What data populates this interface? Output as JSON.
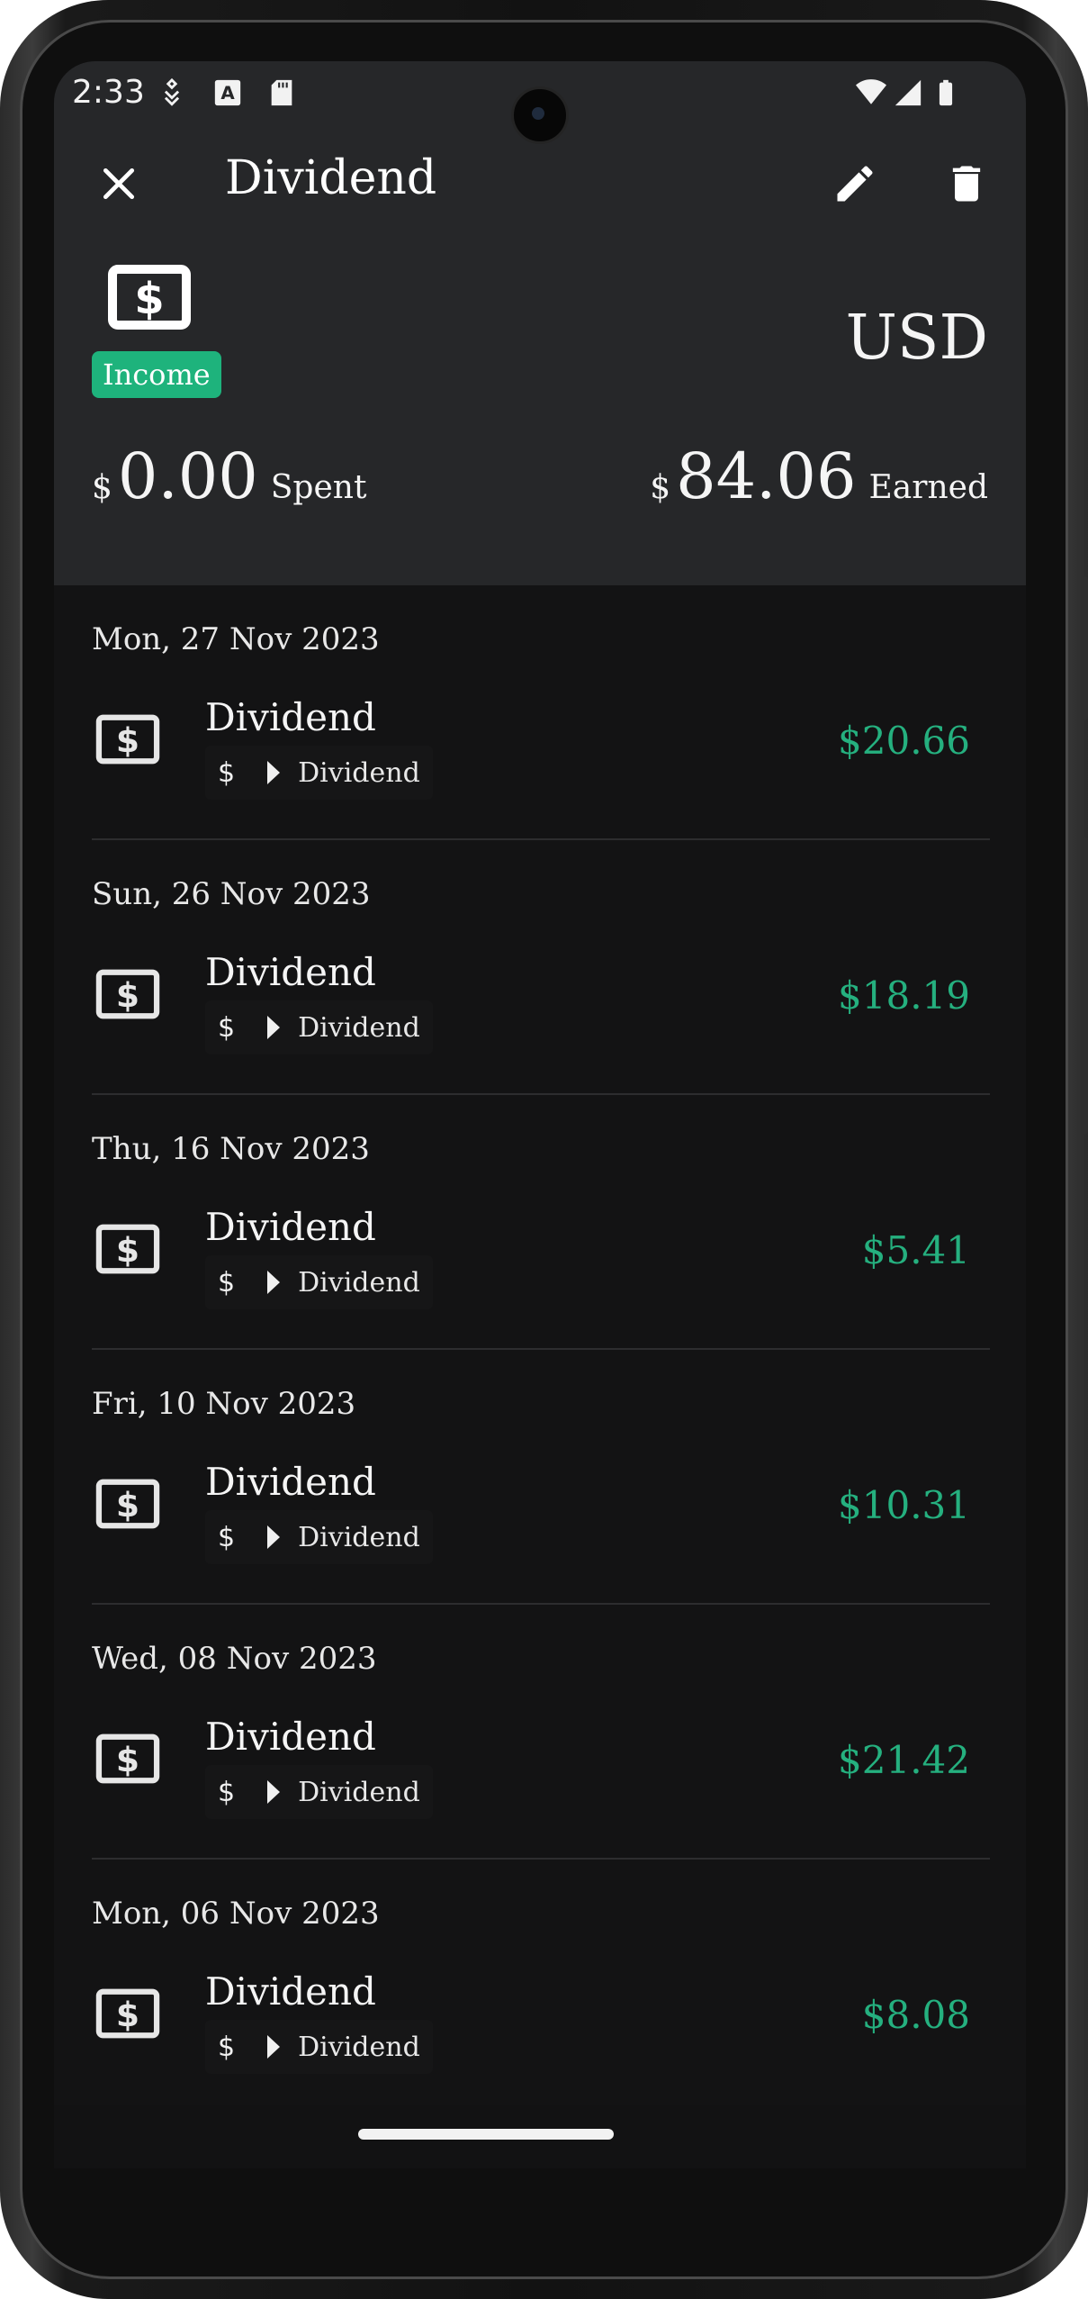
{
  "status_bar": {
    "time": "2:33"
  },
  "header": {
    "title": "Dividend",
    "type_chip": "Income",
    "currency": "USD",
    "spent": {
      "symbol": "$",
      "amount": "0.00",
      "label": "Spent"
    },
    "earned": {
      "symbol": "$",
      "amount": "84.06",
      "label": "Earned"
    }
  },
  "transactions": [
    {
      "date": "Mon, 27 Nov 2023",
      "title": "Dividend",
      "account_symbol": "$",
      "category": "Dividend",
      "amount": "$20.66"
    },
    {
      "date": "Sun, 26 Nov 2023",
      "title": "Dividend",
      "account_symbol": "$",
      "category": "Dividend",
      "amount": "$18.19"
    },
    {
      "date": "Thu, 16 Nov 2023",
      "title": "Dividend",
      "account_symbol": "$",
      "category": "Dividend",
      "amount": "$5.41"
    },
    {
      "date": "Fri, 10 Nov 2023",
      "title": "Dividend",
      "account_symbol": "$",
      "category": "Dividend",
      "amount": "$10.31"
    },
    {
      "date": "Wed, 08 Nov 2023",
      "title": "Dividend",
      "account_symbol": "$",
      "category": "Dividend",
      "amount": "$21.42"
    },
    {
      "date": "Mon, 06 Nov 2023",
      "title": "Dividend",
      "account_symbol": "$",
      "category": "Dividend",
      "amount": "$8.08"
    }
  ],
  "icons": {
    "close": "close-icon",
    "edit": "pencil-icon",
    "delete": "trash-icon",
    "category": "money-bill-icon",
    "arrow": "chevron-right-icon"
  },
  "colors": {
    "income_accent": "#1eb37c",
    "amount_green": "#25b07f",
    "header_bg": "#262729",
    "list_bg": "#131314"
  }
}
